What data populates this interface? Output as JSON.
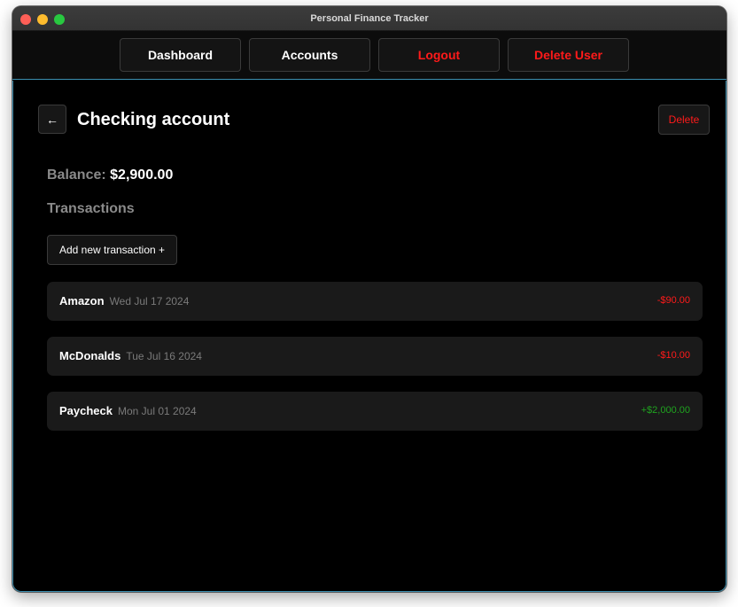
{
  "window": {
    "title": "Personal Finance Tracker"
  },
  "nav": {
    "items": [
      {
        "label": "Dashboard"
      },
      {
        "label": "Accounts"
      },
      {
        "label": "Logout"
      },
      {
        "label": "Delete User"
      }
    ]
  },
  "page": {
    "back_icon": "←",
    "title": "Checking account",
    "delete_label": "Delete",
    "balance_label": "Balance:",
    "balance_value": "$2,900.00",
    "transactions_title": "Transactions",
    "add_label": "Add new transaction +"
  },
  "transactions": [
    {
      "name": "Amazon",
      "date": "Wed Jul 17 2024",
      "amount": "-$90.00",
      "amount_color": "#ff1a1a"
    },
    {
      "name": "McDonalds",
      "date": "Tue Jul 16 2024",
      "amount": "-$10.00",
      "amount_color": "#ff1a1a"
    },
    {
      "name": "Paycheck",
      "date": "Mon Jul 01 2024",
      "amount": "+$2,000.00",
      "amount_color": "#1fa31f"
    }
  ],
  "colors": {
    "accent_border": "#3c8fb0",
    "danger": "#ff1a1a",
    "positive": "#1fa31f"
  }
}
